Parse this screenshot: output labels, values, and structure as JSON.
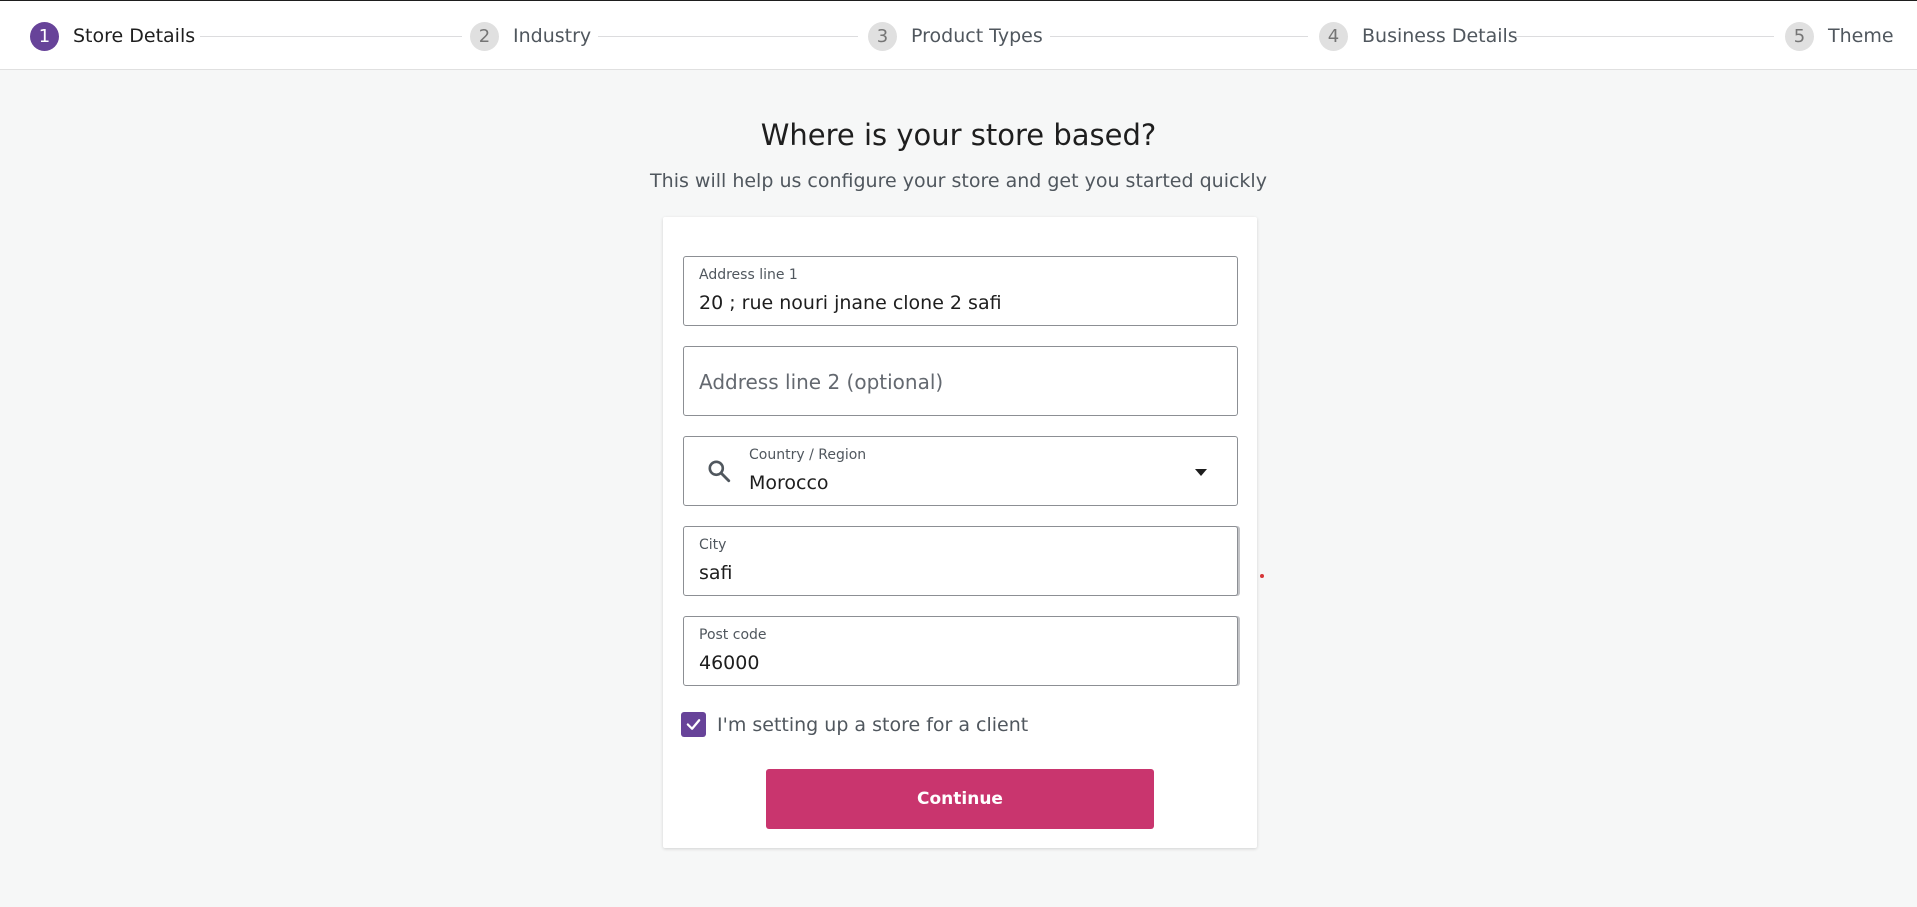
{
  "stepper": {
    "steps": [
      {
        "number": "1",
        "label": "Store Details",
        "active": true
      },
      {
        "number": "2",
        "label": "Industry",
        "active": false
      },
      {
        "number": "3",
        "label": "Product Types",
        "active": false
      },
      {
        "number": "4",
        "label": "Business Details",
        "active": false
      },
      {
        "number": "5",
        "label": "Theme",
        "active": false
      }
    ]
  },
  "header": {
    "title": "Where is your store based?",
    "subtitle": "This will help us configure your store and get you started quickly"
  },
  "form": {
    "address1": {
      "label": "Address line 1",
      "value": "20 ; rue nouri jnane clone 2 safi"
    },
    "address2": {
      "placeholder": "Address line 2 (optional)"
    },
    "country": {
      "label": "Country / Region",
      "value": "Morocco",
      "icon": "search-icon"
    },
    "city": {
      "label": "City",
      "value": "safi"
    },
    "postcode": {
      "label": "Post code",
      "value": "46000"
    },
    "client_checkbox": {
      "label": "I'm setting up a store for a client",
      "checked": true
    },
    "continue_label": "Continue"
  },
  "colors": {
    "accent": "#674399",
    "button": "#c9356e"
  }
}
